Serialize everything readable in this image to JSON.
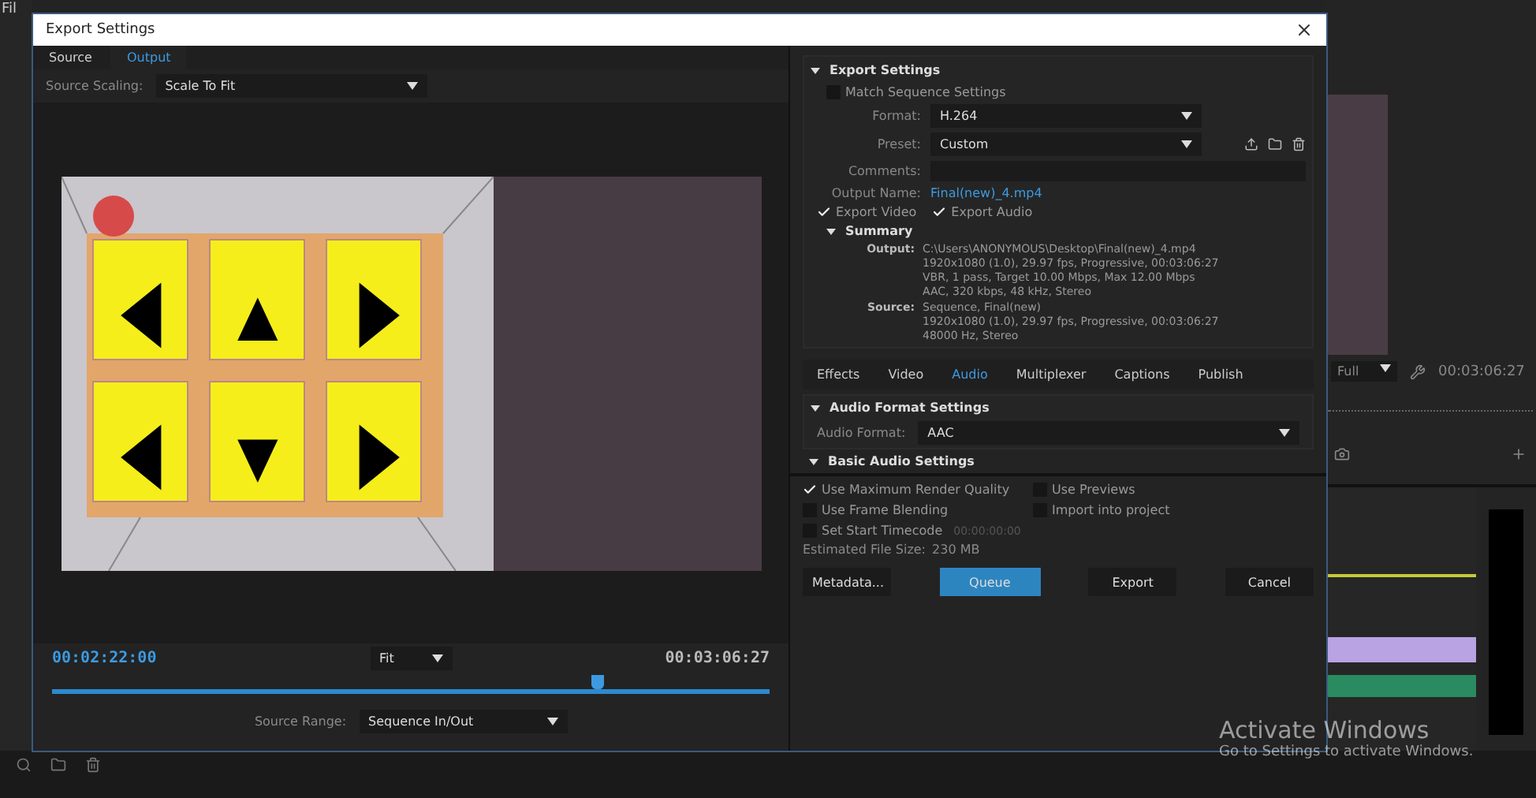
{
  "background_app": {
    "menu_fragment": "Fil",
    "monitor": {
      "zoom": "Full",
      "timecode": "00:03:06:27"
    }
  },
  "dialog": {
    "title": "Export Settings",
    "left": {
      "tabs": [
        {
          "label": "Source",
          "selected": false
        },
        {
          "label": "Output",
          "selected": true
        }
      ],
      "source_scaling": {
        "label": "Source Scaling:",
        "value": "Scale To Fit"
      },
      "timecode_in": "00:02:22:00",
      "zoom": "Fit",
      "timecode_out": "00:03:06:27",
      "playhead": {
        "level": 0.76
      },
      "source_range": {
        "label": "Source Range:",
        "value": "Sequence In/Out"
      }
    },
    "export_settings": {
      "heading": "Export Settings",
      "expanded": true,
      "match_sequence": {
        "label": "Match Sequence Settings",
        "checked": false
      },
      "format": {
        "label": "Format:",
        "value": "H.264"
      },
      "preset": {
        "label": "Preset:",
        "value": "Custom"
      },
      "comments": {
        "label": "Comments:"
      },
      "output_name": {
        "label": "Output Name:",
        "value": "Final(new)_4.mp4"
      },
      "export_video": {
        "label": "Export Video",
        "checked": true
      },
      "export_audio": {
        "label": "Export Audio",
        "checked": true
      },
      "summary": {
        "heading": "Summary",
        "output": {
          "label": "Output:",
          "lines": [
            "C:\\Users\\ANONYMOUS\\Desktop\\Final(new)_4.mp4",
            "1920x1080 (1.0), 29.97 fps, Progressive, 00:03:06:27",
            "VBR, 1 pass, Target 10.00 Mbps, Max 12.00 Mbps",
            "AAC, 320 kbps, 48 kHz, Stereo"
          ]
        },
        "source": {
          "label": "Source:",
          "lines": [
            "Sequence, Final(new)",
            "1920x1080 (1.0), 29.97 fps, Progressive, 00:03:06:27",
            "48000 Hz, Stereo"
          ]
        }
      }
    },
    "tabs": [
      {
        "label": "Effects",
        "selected": false
      },
      {
        "label": "Video",
        "selected": false
      },
      {
        "label": "Audio",
        "selected": true
      },
      {
        "label": "Multiplexer",
        "selected": false
      },
      {
        "label": "Captions",
        "selected": false
      },
      {
        "label": "Publish",
        "selected": false
      }
    ],
    "audio_format_settings": {
      "heading": "Audio Format Settings",
      "audio_format": {
        "label": "Audio Format:",
        "value": "AAC"
      }
    },
    "basic_audio_heading": "Basic Audio Settings",
    "options": [
      {
        "label": "Use Maximum Render Quality",
        "checked": true
      },
      {
        "label": "Use Previews",
        "checked": false
      },
      {
        "label": "Use Frame Blending",
        "checked": false
      },
      {
        "label": "Import into project",
        "checked": false
      },
      {
        "label": "Set Start Timecode",
        "checked": false,
        "value": "00:00:00:00"
      }
    ],
    "file_size": {
      "label": "Estimated File Size:",
      "value": "230 MB"
    },
    "buttons": [
      {
        "label": "Metadata...",
        "kind": "plain"
      },
      {
        "label": "Queue",
        "kind": "primary"
      },
      {
        "label": "Export",
        "kind": "plain"
      },
      {
        "label": "Cancel",
        "kind": "plain"
      }
    ]
  },
  "os_notice": {
    "title": "Activate Windows",
    "text": "Go to Settings to activate Windows."
  }
}
